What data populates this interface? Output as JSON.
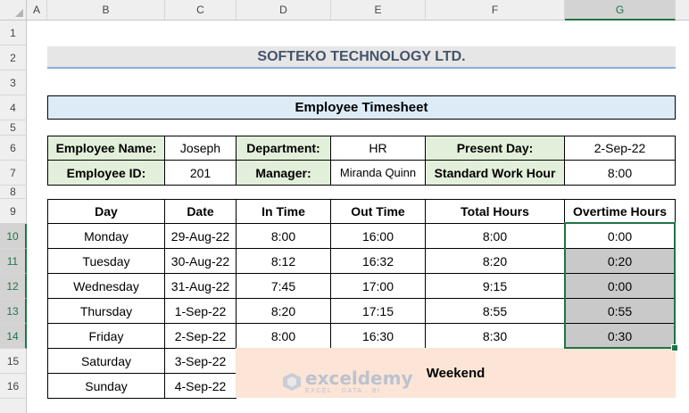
{
  "columns": [
    "A",
    "B",
    "C",
    "D",
    "E",
    "F",
    "G"
  ],
  "rows": [
    "1",
    "2",
    "3",
    "4",
    "5",
    "6",
    "7",
    "8",
    "9",
    "10",
    "11",
    "12",
    "13",
    "14",
    "15",
    "16"
  ],
  "title": "SOFTEKO TECHNOLOGY LTD.",
  "subtitle": "Employee Timesheet",
  "info": {
    "employee_name_label": "Employee Name:",
    "employee_name": "Joseph",
    "department_label": "Department:",
    "department": "HR",
    "present_day_label": "Present Day:",
    "present_day": "2-Sep-22",
    "employee_id_label": "Employee ID:",
    "employee_id": "201",
    "manager_label": "Manager:",
    "manager": "Miranda Quinn",
    "standard_hour_label": "Standard Work Hour",
    "standard_hour": "8:00"
  },
  "table": {
    "headers": [
      "Day",
      "Date",
      "In Time",
      "Out Time",
      "Total Hours",
      "Overtime Hours"
    ],
    "rows": [
      [
        "Monday",
        "29-Aug-22",
        "8:00",
        "16:00",
        "8:00",
        "0:00"
      ],
      [
        "Tuesday",
        "30-Aug-22",
        "8:12",
        "16:32",
        "8:20",
        "0:20"
      ],
      [
        "Wednesday",
        "31-Aug-22",
        "7:45",
        "17:00",
        "9:15",
        "0:00"
      ],
      [
        "Thursday",
        "1-Sep-22",
        "8:20",
        "17:15",
        "8:55",
        "0:55"
      ],
      [
        "Friday",
        "2-Sep-22",
        "8:00",
        "16:30",
        "8:30",
        "0:30"
      ]
    ],
    "weekend_rows": [
      [
        "Saturday",
        "3-Sep-22"
      ],
      [
        "Sunday",
        "4-Sep-22"
      ]
    ],
    "weekend_label": "Weekend"
  },
  "watermark": {
    "name": "exceldemy",
    "tagline": "EXCEL · DATA · BI"
  },
  "colors": {
    "accent_green": "#217346",
    "label_fill": "#e2efda",
    "highlight_fill": "#c9c9c9",
    "weekend_fill": "#fce4d6",
    "subtitle_fill": "#ddebf7",
    "title_fill": "#e7e6e6"
  }
}
